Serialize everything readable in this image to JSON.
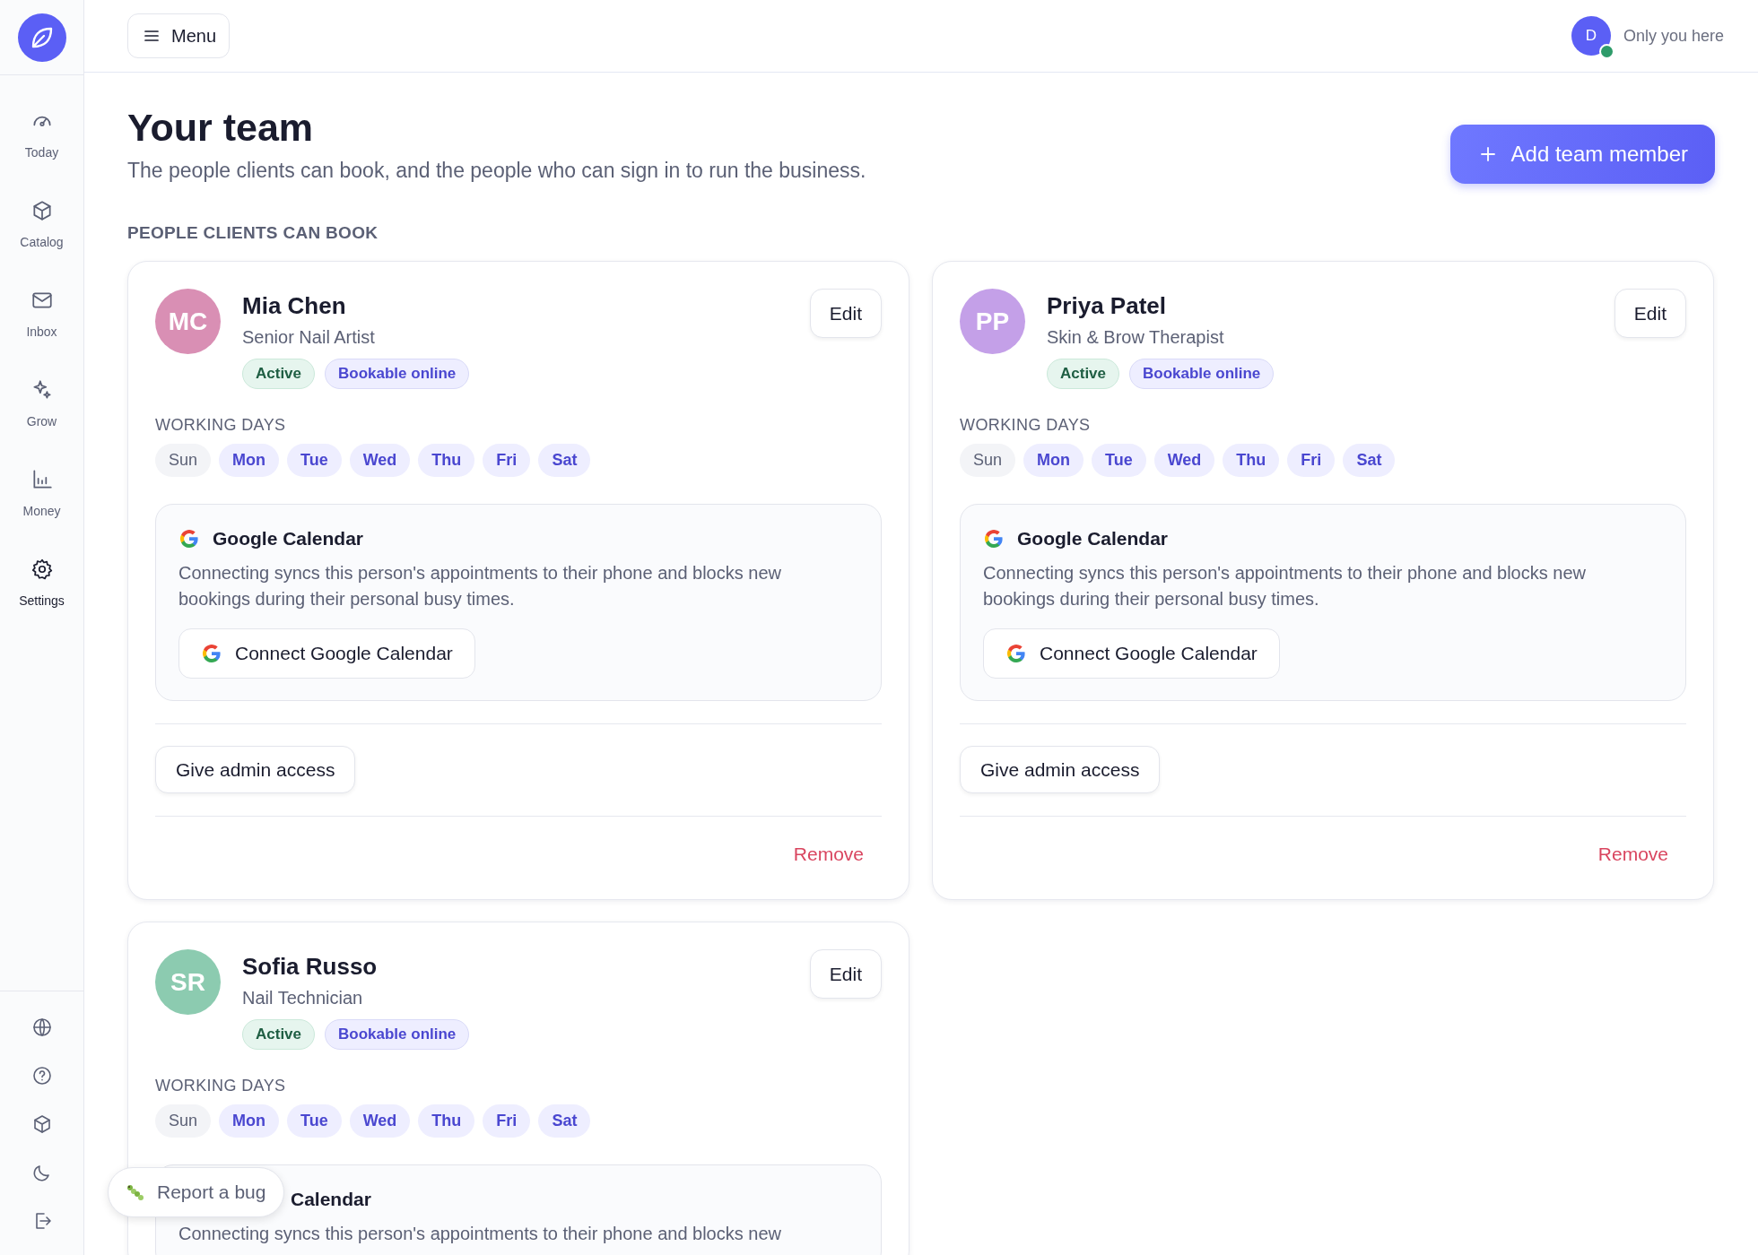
{
  "sidebar": {
    "nav": [
      {
        "label": "Today",
        "kind": "gauge",
        "selected": false
      },
      {
        "label": "Catalog",
        "kind": "box",
        "selected": false
      },
      {
        "label": "Inbox",
        "kind": "mail",
        "selected": false
      },
      {
        "label": "Grow",
        "kind": "sparkle",
        "selected": false
      },
      {
        "label": "Money",
        "kind": "chart",
        "selected": false
      },
      {
        "label": "Settings",
        "kind": "gear",
        "selected": true
      }
    ],
    "footer": [
      {
        "kind": "globe"
      },
      {
        "kind": "help"
      },
      {
        "kind": "box"
      },
      {
        "kind": "moon"
      },
      {
        "kind": "logout"
      }
    ]
  },
  "topbar": {
    "menu_button": "Menu",
    "user": {
      "initial": "D",
      "online": true,
      "status": "Only you here"
    }
  },
  "header": {
    "title": "Your team",
    "subtitle": "The people clients can book, and the people who can sign in to run the business.",
    "add_button": "Add team member"
  },
  "section_label": "PEOPLE CLIENTS CAN BOOK",
  "members": [
    {
      "initials": "MC",
      "color": "#d98fb4",
      "name": "Mia Chen",
      "role": "Senior Nail Artist",
      "edit": "Edit",
      "badges": [
        {
          "label": "Active",
          "kind": "status"
        },
        {
          "label": "Bookable online",
          "kind": "booking"
        }
      ],
      "days_label": "WORKING DAYS",
      "days": [
        {
          "label": "Sun",
          "on": false
        },
        {
          "label": "Mon",
          "on": true
        },
        {
          "label": "Tue",
          "on": true
        },
        {
          "label": "Wed",
          "on": true
        },
        {
          "label": "Thu",
          "on": true
        },
        {
          "label": "Fri",
          "on": true
        },
        {
          "label": "Sat",
          "on": true
        }
      ],
      "calendar": {
        "title": "Google Calendar",
        "clipped": false,
        "description": "Connecting syncs this person's appointments to their phone and blocks new bookings during their personal busy times.",
        "button": "Connect Google Calendar"
      },
      "admin_button": "Give admin access",
      "remove_button": "Remove"
    },
    {
      "initials": "PP",
      "color": "#c4a0e8",
      "name": "Priya Patel",
      "role": "Skin & Brow Therapist",
      "edit": "Edit",
      "badges": [
        {
          "label": "Active",
          "kind": "status"
        },
        {
          "label": "Bookable online",
          "kind": "booking"
        }
      ],
      "days_label": "WORKING DAYS",
      "days": [
        {
          "label": "Sun",
          "on": false
        },
        {
          "label": "Mon",
          "on": true
        },
        {
          "label": "Tue",
          "on": true
        },
        {
          "label": "Wed",
          "on": true
        },
        {
          "label": "Thu",
          "on": true
        },
        {
          "label": "Fri",
          "on": true
        },
        {
          "label": "Sat",
          "on": true
        }
      ],
      "calendar": {
        "title": "Google Calendar",
        "clipped": false,
        "description": "Connecting syncs this person's appointments to their phone and blocks new bookings during their personal busy times.",
        "button": "Connect Google Calendar"
      },
      "admin_button": "Give admin access",
      "remove_button": "Remove"
    },
    {
      "initials": "SR",
      "color": "#8ccbb0",
      "name": "Sofia Russo",
      "role": "Nail Technician",
      "edit": "Edit",
      "badges": [
        {
          "label": "Active",
          "kind": "status"
        },
        {
          "label": "Bookable online",
          "kind": "booking"
        }
      ],
      "days_label": "WORKING DAYS",
      "days": [
        {
          "label": "Sun",
          "on": false
        },
        {
          "label": "Mon",
          "on": true
        },
        {
          "label": "Tue",
          "on": true
        },
        {
          "label": "Wed",
          "on": true
        },
        {
          "label": "Thu",
          "on": true
        },
        {
          "label": "Fri",
          "on": true
        },
        {
          "label": "Sat",
          "on": true
        }
      ],
      "calendar": {
        "title": "Calendar",
        "clipped": true,
        "description": "Connecting syncs this person's appointments to their phone and blocks new"
      }
    }
  ],
  "report_button": "Report a bug"
}
